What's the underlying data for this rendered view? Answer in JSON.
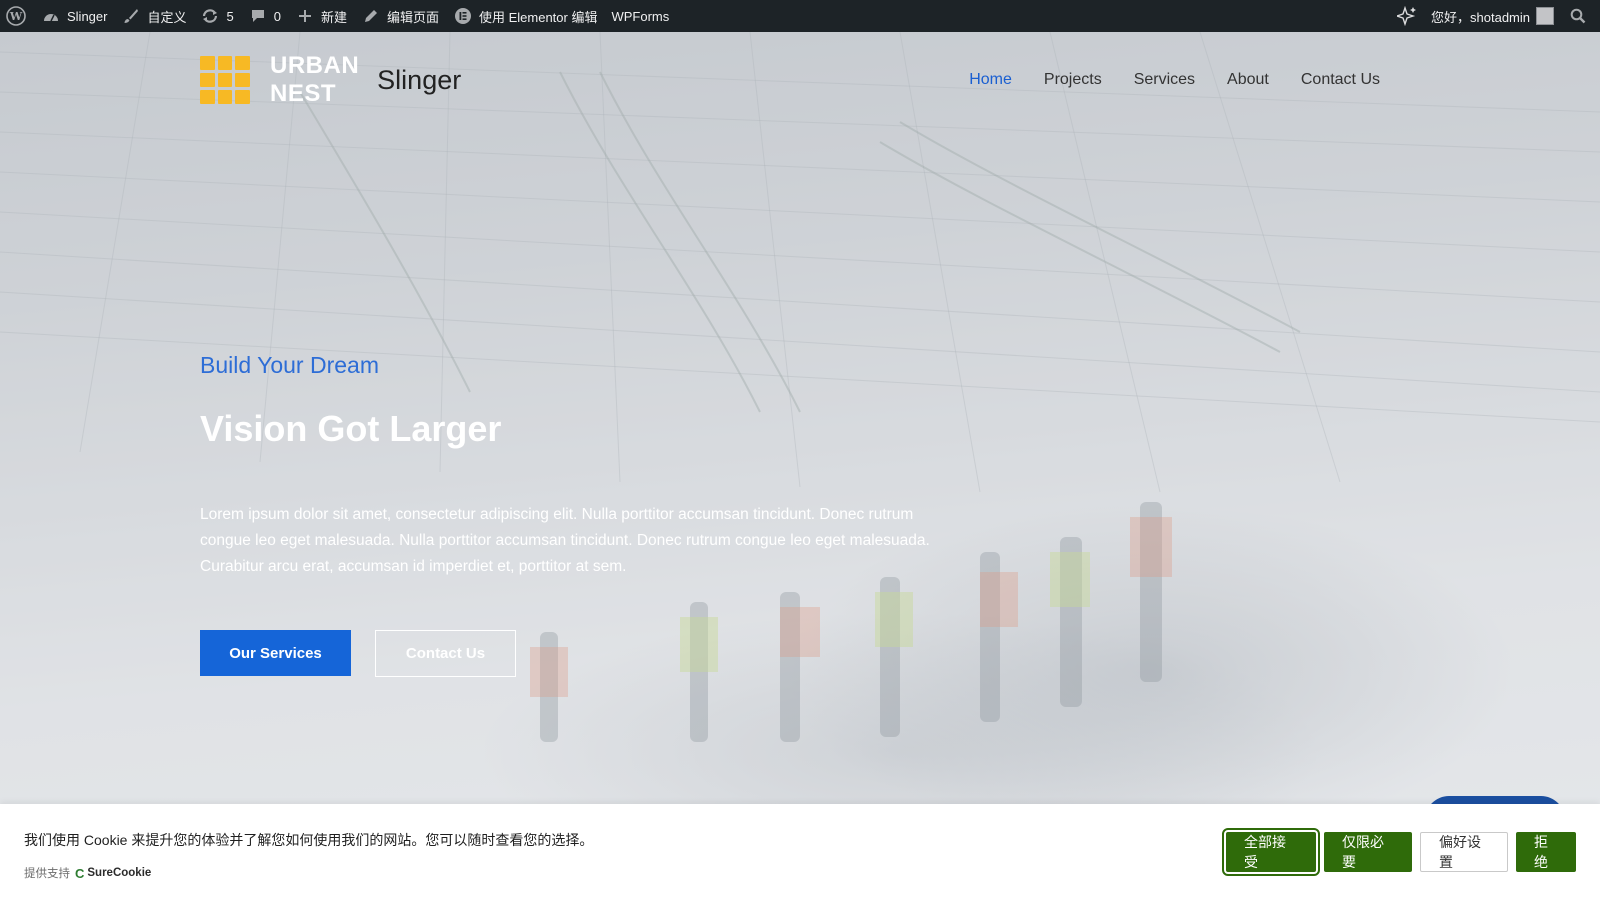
{
  "adminbar": {
    "site": "Slinger",
    "customize": "自定义",
    "updates": "5",
    "comments": "0",
    "new": "新建",
    "edit_page": "编辑页面",
    "elementor": "使用 Elementor 编辑",
    "wpforms": "WPForms",
    "greeting": "您好，shotadmin"
  },
  "header": {
    "logo_line1": "URBAN",
    "logo_line2": "NEST",
    "site_title": "Slinger",
    "nav": [
      {
        "label": "Home",
        "active": true
      },
      {
        "label": "Projects"
      },
      {
        "label": "Services"
      },
      {
        "label": "About"
      },
      {
        "label": "Contact Us"
      }
    ]
  },
  "hero": {
    "kicker": "Build Your Dream",
    "headline": "Vision Got Larger",
    "lead": "Lorem ipsum dolor sit amet, consectetur adipiscing elit. Nulla porttitor accumsan tincidunt. Donec rutrum congue leo eget malesuada. Nulla porttitor accumsan tincidunt. Donec rutrum congue leo eget malesuada. Curabitur arcu erat, accumsan id imperdiet et, porttitor at sem.",
    "primary_button": "Our Services",
    "secondary_button": "Contact Us"
  },
  "cookie": {
    "message": "我们使用 Cookie 来提升您的体验并了解您如何使用我们的网站。您可以随时查看您的选择。",
    "powered_by": "提供支持",
    "brand": "SureCookie",
    "accept_all": "全部接受",
    "necessary_only": "仅限必要",
    "preferences": "偏好设置",
    "reject": "拒绝"
  },
  "colors": {
    "accent": "#1565d8",
    "logo_yellow": "#f7b924",
    "cookie_green": "#2f6b0a",
    "adminbar_bg": "#1d2327"
  }
}
